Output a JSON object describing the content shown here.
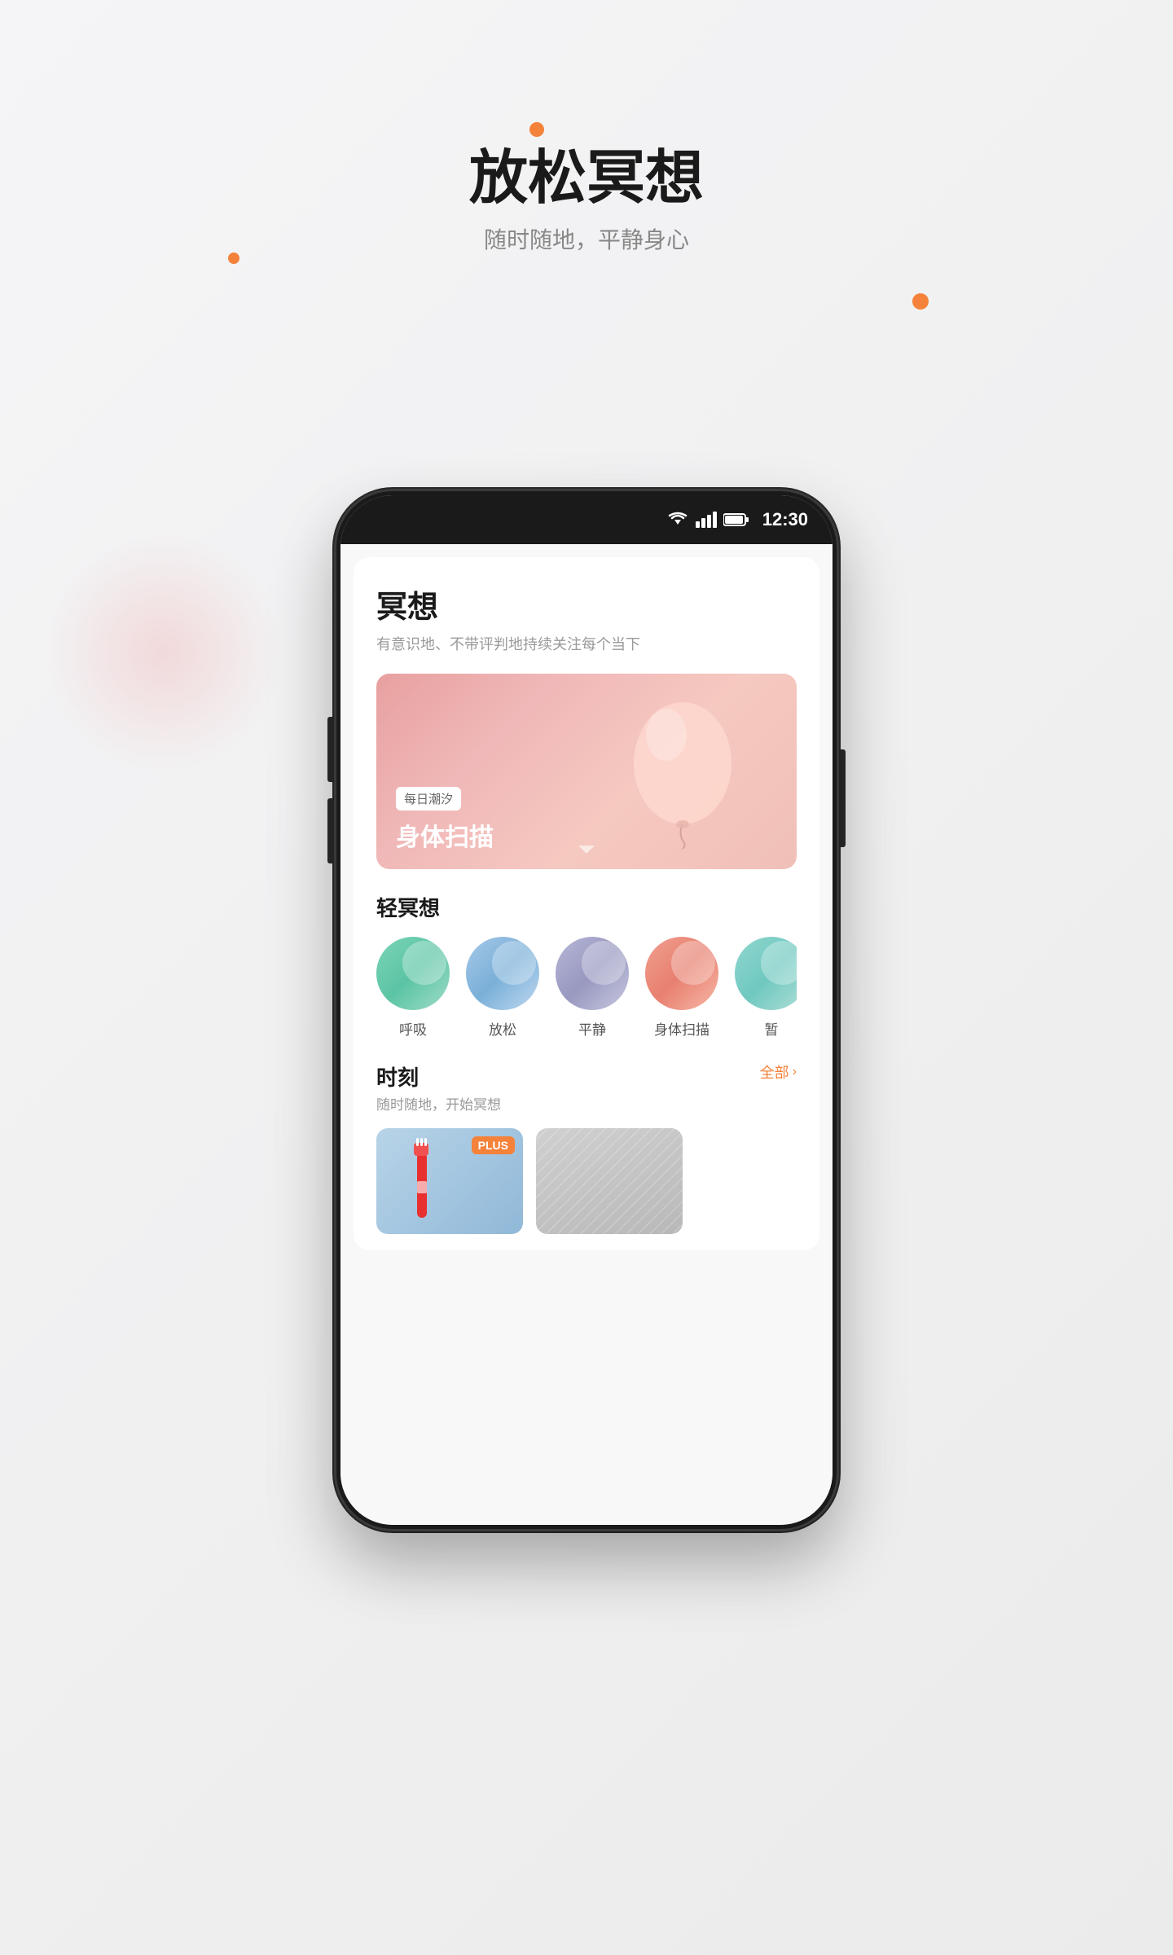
{
  "page": {
    "background_title": "放松冥想",
    "background_subtitle": "随时随地，平静身心"
  },
  "status_bar": {
    "time": "12:30"
  },
  "app_content": {
    "page_title": "冥想",
    "page_subtitle": "有意识地、不带评判地持续关注每个当下",
    "hero": {
      "tag": "每日潮汐",
      "title": "身体扫描"
    },
    "light_meditation": {
      "section_title": "轻冥想",
      "items": [
        {
          "label": "呼吸",
          "color": "breathing"
        },
        {
          "label": "放松",
          "color": "relax"
        },
        {
          "label": "平静",
          "color": "calm"
        },
        {
          "label": "身体扫描",
          "color": "body"
        },
        {
          "label": "暂",
          "color": "temp"
        }
      ]
    },
    "moments": {
      "section_title": "时刻",
      "section_subtitle": "随时随地，开始冥想",
      "view_all": "全部",
      "cards": [
        {
          "has_plus": true
        },
        {
          "has_plus": false
        }
      ]
    }
  },
  "decorative": {
    "dot1_color": "#f5823a",
    "dot2_color": "#f5823a",
    "dot3_color": "#f5823a"
  }
}
